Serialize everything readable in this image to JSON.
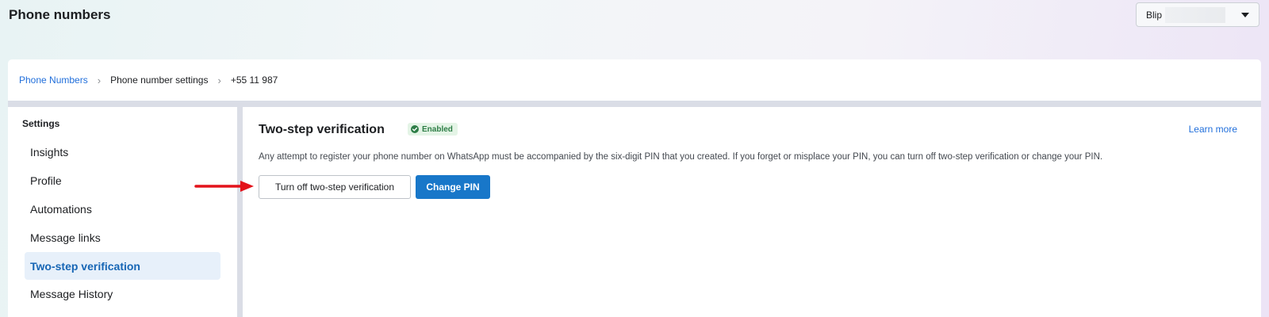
{
  "header": {
    "title": "Phone numbers",
    "account_select": {
      "value": "Blip"
    }
  },
  "breadcrumb": {
    "items": [
      "Phone Numbers",
      "Phone number settings",
      "+55 11 987"
    ]
  },
  "sidebar": {
    "heading": "Settings",
    "items": [
      {
        "label": "Insights"
      },
      {
        "label": "Profile"
      },
      {
        "label": "Automations"
      },
      {
        "label": "Message links"
      },
      {
        "label": "Two-step verification",
        "active": true
      },
      {
        "label": "Message History"
      }
    ]
  },
  "main": {
    "title": "Two-step verification",
    "status": "Enabled",
    "learn_more": "Learn more",
    "description": "Any attempt to register your phone number on WhatsApp must be accompanied by the six-digit PIN that you created. If you forget or misplace your PIN, you can turn off two-step verification or change your PIN.",
    "turn_off_label": "Turn off two-step verification",
    "change_pin_label": "Change PIN"
  },
  "colors": {
    "accent": "#1877c9",
    "link": "#216fdb",
    "status_green": "#2d7d46",
    "active_bg": "#e7f0fa",
    "annotation_arrow": "#e3131b"
  },
  "icons": {
    "status": "check-circle-icon",
    "breadcrumb_separator": "chevron-right-icon",
    "dropdown": "caret-down-icon",
    "annotation": "red-arrow-icon"
  }
}
